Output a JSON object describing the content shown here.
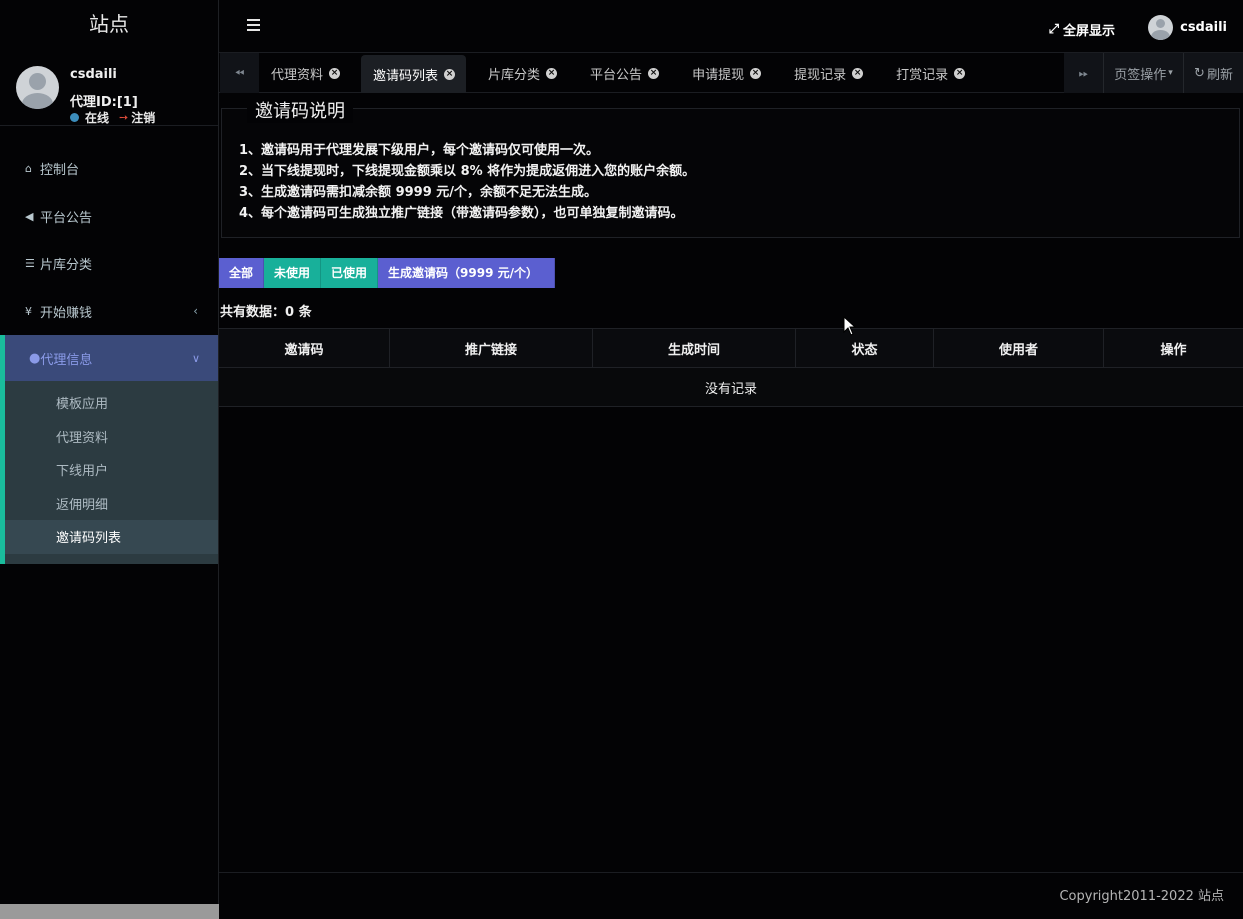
{
  "site": {
    "title": "站点"
  },
  "user": {
    "name": "csdaili",
    "id_label": "代理ID:[1]",
    "status_online": "在线",
    "logout": "注销"
  },
  "nav": {
    "items": [
      {
        "label": "控制台",
        "icon": "home-icon"
      },
      {
        "label": "平台公告",
        "icon": "bullhorn-icon"
      },
      {
        "label": "片库分类",
        "icon": "list-icon"
      },
      {
        "label": "开始赚钱",
        "icon": "yen-icon"
      }
    ],
    "group": {
      "label": "代理信息",
      "icon": "user-icon",
      "children": [
        "模板应用",
        "代理资料",
        "下线用户",
        "返佣明细",
        "邀请码列表"
      ],
      "active_index": 4
    }
  },
  "header": {
    "fullscreen": "全屏显示",
    "username": "csdaili"
  },
  "tabs": {
    "items": [
      "代理资料",
      "邀请码列表",
      "片库分类",
      "平台公告",
      "申请提现",
      "提现记录",
      "打赏记录"
    ],
    "active_index": 1,
    "ops": "页签操作",
    "refresh": "刷新"
  },
  "info": {
    "title": "邀请码说明",
    "lines": [
      "1、邀请码用于代理发展下级用户，每个邀请码仅可使用一次。",
      "2、当下线提现时，下线提现金额乘以 8% 将作为提成返佣进入您的账户余额。",
      "3、生成邀请码需扣减余额 9999 元/个，余额不足无法生成。",
      "4、每个邀请码可生成独立推广链接（带邀请码参数），也可单独复制邀请码。"
    ]
  },
  "filters": {
    "all": "全部",
    "unused": "未使用",
    "used": "已使用",
    "generate": "生成邀请码（9999 元/个）"
  },
  "count": "共有数据：0 条",
  "table": {
    "columns": [
      "邀请码",
      "推广链接",
      "生成时间",
      "状态",
      "使用者",
      "操作"
    ],
    "empty": "没有记录"
  },
  "footer": {
    "copyright": "Copyright2011-2022 站点"
  },
  "colors": {
    "background": "#030305",
    "primary": "#5b5fd0",
    "teal": "#18b09a",
    "sidebar_submenu": "#2c3b41"
  }
}
